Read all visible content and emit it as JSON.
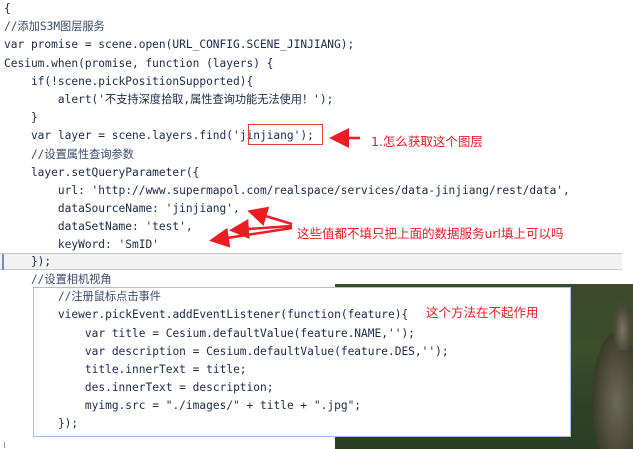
{
  "editor": {
    "upper_lines": [
      "{",
      "//添加S3M图层服务",
      "var promise = scene.open(URL_CONFIG.SCENE_JINJIANG);",
      "Cesium.when(promise, function (layers) {",
      "    if(!scene.pickPositionSupported){",
      "        alert('不支持深度拾取,属性查询功能无法使用！');",
      "    }",
      "    var layer = scene.layers.find('jinjiang');",
      "    //设置属性查询参数",
      "    layer.setQueryParameter({",
      "        url: 'http://www.supermapol.com/realspace/services/data-jinjiang/rest/data',",
      "        dataSourceName: 'jinjiang',",
      "        dataSetName: 'test',",
      "        keyWord: 'SmID'",
      "    });",
      "    //设置相机视角"
    ],
    "lower_lines": [
      "    //注册鼠标点击事件",
      "    viewer.pickEvent.addEventListener(function(feature){",
      "        var title = Cesium.defaultValue(feature.NAME,'');",
      "        var description = Cesium.defaultValue(feature.DES,'');",
      "        title.innerText = title;",
      "        des.innerText = description;",
      "        myimg.src = \"./images/\" + title + \".jpg\";",
      "    });"
    ]
  },
  "annotations": {
    "note1": "1.怎么获取这个图层",
    "note2": "这些值都不填只把上面的数据服务url填上可以吗",
    "note3": "这个方法在不起作用"
  },
  "colors": {
    "annotation_red": "#ec1c24",
    "code_text": "#1a2a4a",
    "frame_border": "#9fc3e8"
  }
}
